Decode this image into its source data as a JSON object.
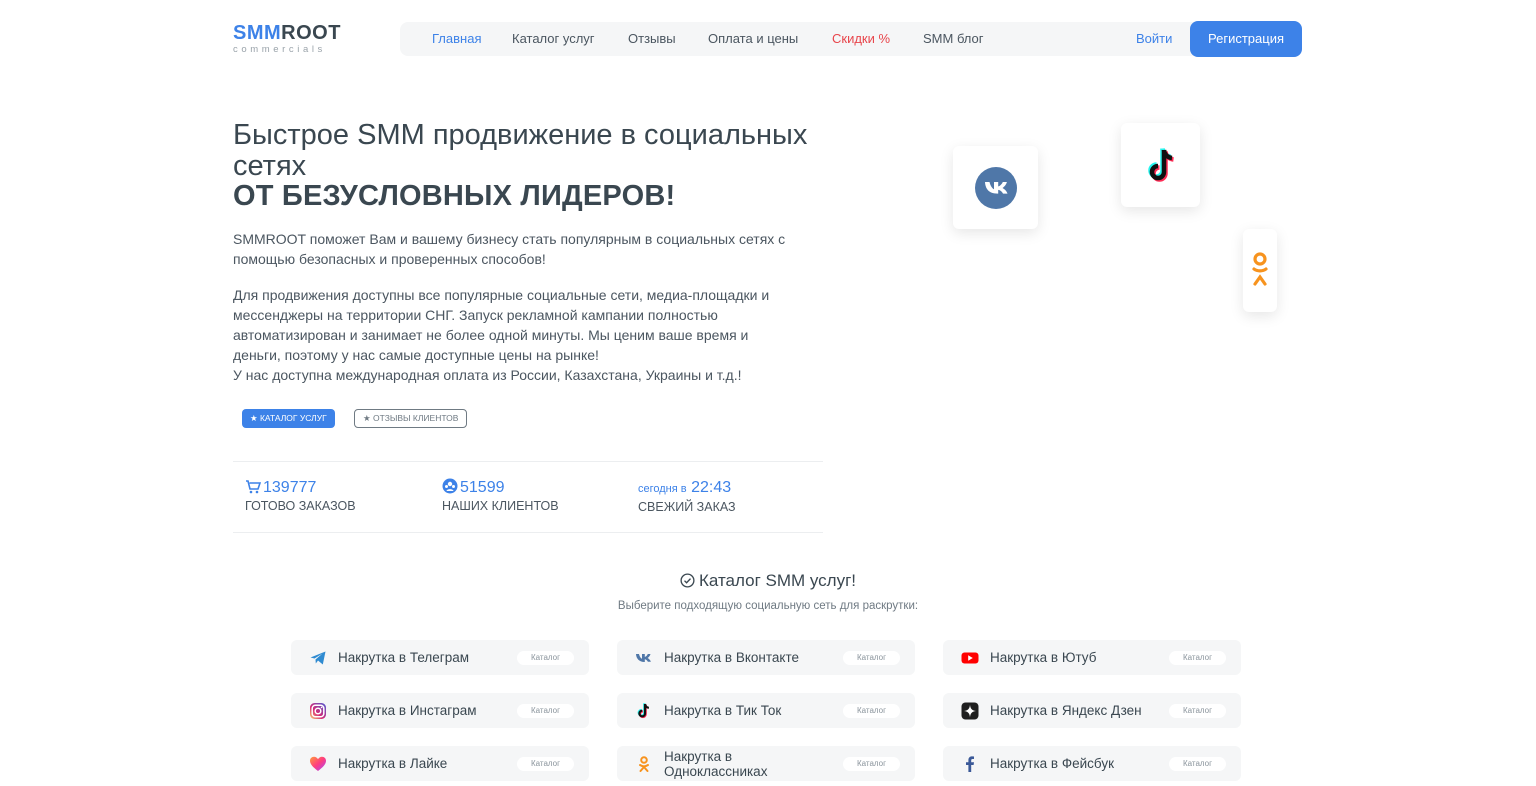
{
  "brand": {
    "name_accent": "SMM",
    "name_rest": "ROOT",
    "tagline": "commercials",
    "accent_color": "#3d82e8"
  },
  "nav": {
    "items": [
      {
        "label": "Главная",
        "state": "active"
      },
      {
        "label": "Каталог услуг",
        "state": "normal"
      },
      {
        "label": "Отзывы",
        "state": "normal"
      },
      {
        "label": "Оплата и цены",
        "state": "normal"
      },
      {
        "label": "Скидки %",
        "state": "highlight"
      },
      {
        "label": "SMM блог",
        "state": "normal"
      }
    ],
    "login": "Войти",
    "register": "Регистрация"
  },
  "hero": {
    "title": "Быстрое SMM продвижение в социальных сетях",
    "title_strong": "ОТ БЕЗУСЛОВНЫХ ЛИДЕРОВ!",
    "paragraph1": "SMMROOT поможет Вам и вашему бизнесу стать популярным в социальных сетях с помощью безопасных и проверенных способов!",
    "paragraph2_lines": [
      "Для продвижения доступны все популярные социальные сети, медиа-площадки и",
      "мессенджеры на территории СНГ. Запуск рекламной кампании полностью",
      "автоматизирован и занимает не более одной минуты. Мы ценим ваше время и",
      "деньги, поэтому у нас самые доступные цены на рынке!",
      "У нас доступна международная оплата из России, Казахстана, Украины и т.д.!"
    ],
    "btn_catalog": "★ КАТАЛОГ УСЛУГ",
    "btn_reviews": "★ ОТЗЫВЫ КЛИЕНТОВ"
  },
  "stats": {
    "orders": {
      "value": "139777",
      "label": "ГОТОВО ЗАКАЗОВ",
      "icon": "cart-icon"
    },
    "clients": {
      "value": "51599",
      "label": "НАШИХ КЛИЕНТОВ",
      "icon": "users-icon"
    },
    "last_order": {
      "prefix": "сегодня в",
      "value": "22:43",
      "label": "СВЕЖИЙ ЗАКАЗ"
    }
  },
  "floating_icons": [
    "vk-icon",
    "tiktok-icon",
    "odnoklassniki-icon"
  ],
  "catalog": {
    "title": "Каталог SMM услуг!",
    "subtitle": "Выберите подходящую социальную сеть для раскрутки:",
    "badge": "Каталог",
    "services": [
      {
        "label": "Накрутка в Телеграм",
        "icon": "telegram-icon"
      },
      {
        "label": "Накрутка в Вконтакте",
        "icon": "vk-icon"
      },
      {
        "label": "Накрутка в Ютуб",
        "icon": "youtube-icon"
      },
      {
        "label": "Накрутка в Инстаграм",
        "icon": "instagram-icon"
      },
      {
        "label": "Накрутка в Тик Ток",
        "icon": "tiktok-icon"
      },
      {
        "label": "Накрутка в Яндекс Дзен",
        "icon": "yandex-zen-icon"
      },
      {
        "label": "Накрутка в Лайке",
        "icon": "likee-icon"
      },
      {
        "label": "Накрутка в Одноклассниках",
        "icon": "odnoklassniki-icon"
      },
      {
        "label": "Накрутка в Фейсбук",
        "icon": "facebook-icon"
      }
    ]
  }
}
